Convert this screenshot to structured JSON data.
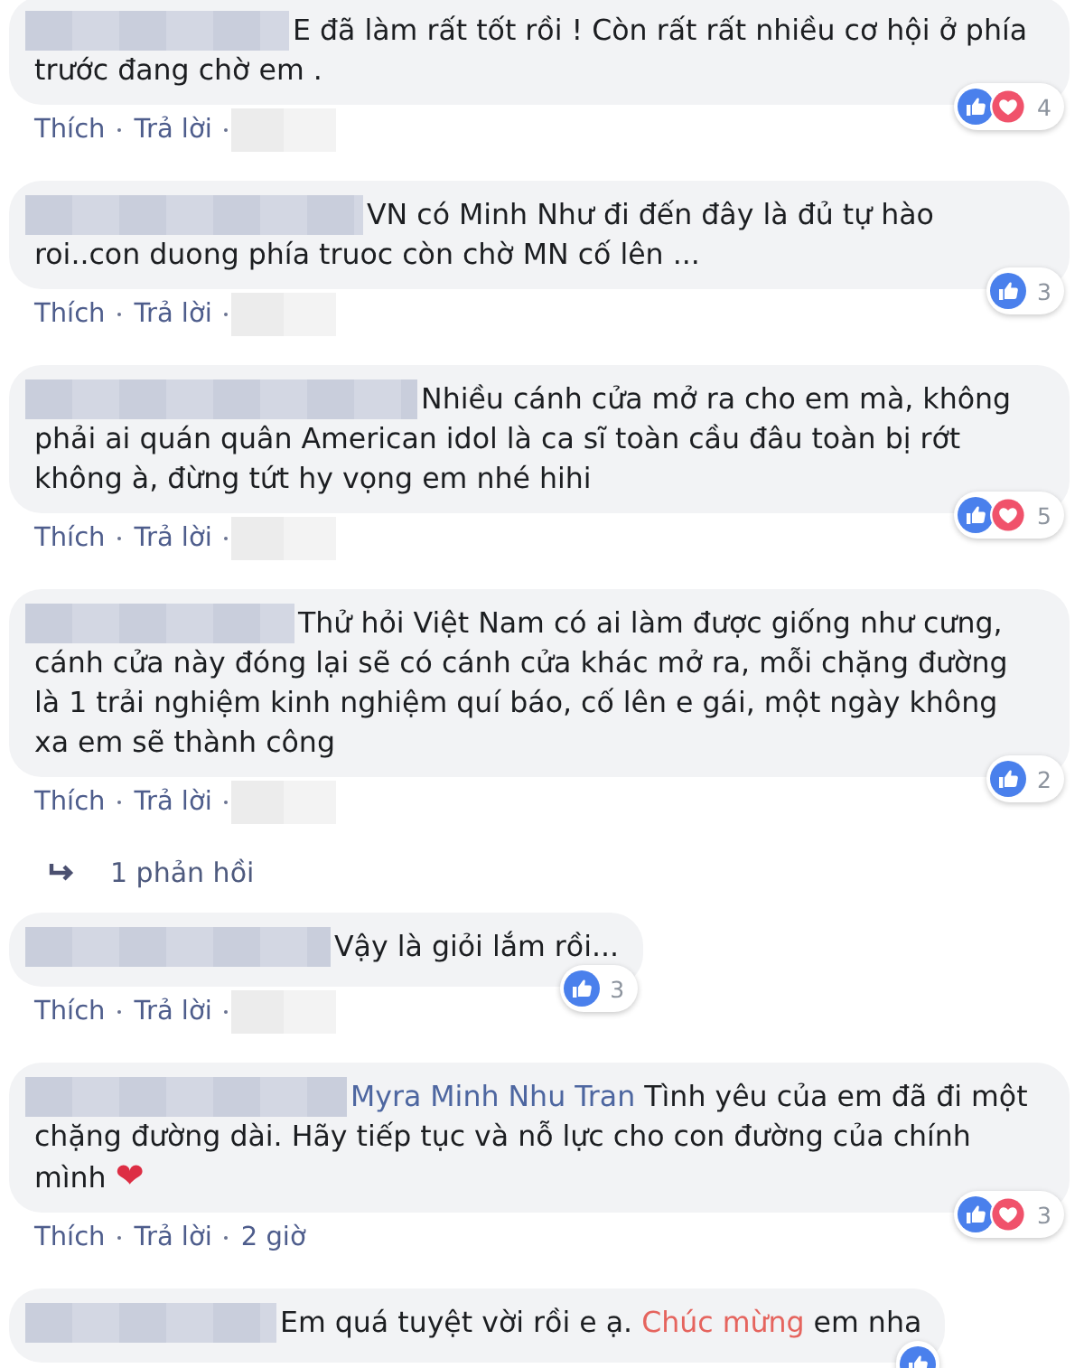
{
  "comments": [
    {
      "author_hidden": true,
      "text": [
        {
          "kind": "plain",
          "text": "E đã làm rất tốt rồi ! Còn rất rất nhiều cơ hội ở phía trước đang chờ em ."
        }
      ],
      "reactions": {
        "icons": [
          {
            "kind": "like"
          },
          {
            "kind": "love"
          }
        ],
        "count": "4"
      },
      "actions": [
        "Thích",
        "Trả lời"
      ],
      "time_hidden": true
    },
    {
      "author_hidden": true,
      "text": [
        {
          "kind": "plain",
          "text": "VN có Minh Như đi đến đây là đủ tự hào roi..con duong phía truoc còn chờ MN cố lên ..."
        }
      ],
      "reactions": {
        "icons": [
          {
            "kind": "like"
          }
        ],
        "count": "3"
      },
      "actions": [
        "Thích",
        "Trả lời"
      ],
      "time_hidden": true
    },
    {
      "author_hidden": true,
      "text": [
        {
          "kind": "plain",
          "text": "Nhiều cánh cửa mở ra cho em mà, không phải ai quán quân American idol là ca sĩ toàn cầu đâu toàn bị rớt không à, đừng tứt hy vọng em nhé hihi"
        }
      ],
      "reactions": {
        "icons": [
          {
            "kind": "like"
          },
          {
            "kind": "love"
          }
        ],
        "count": "5"
      },
      "actions": [
        "Thích",
        "Trả lời"
      ],
      "time_hidden": true
    },
    {
      "author_hidden": true,
      "text": [
        {
          "kind": "plain",
          "text": "Thử hỏi Việt Nam có ai làm được giống như cưng, cánh cửa này đóng lại sẽ có cánh cửa khác mở ra, mỗi chặng đường là 1 trải nghiệm kinh nghiệm quí báo, cố lên e gái, một ngày không xa em sẽ thành công"
        }
      ],
      "reactions": {
        "icons": [
          {
            "kind": "like"
          }
        ],
        "count": "2"
      },
      "actions": [
        "Thích",
        "Trả lời"
      ],
      "time_hidden": true,
      "replies": "1 phản hồi"
    },
    {
      "author_hidden": true,
      "text": [
        {
          "kind": "plain",
          "text": "Vậy là giỏi lắm rồi..."
        }
      ],
      "reactions": {
        "icons": [
          {
            "kind": "like"
          }
        ],
        "count": "3"
      },
      "actions": [
        "Thích",
        "Trả lời"
      ],
      "time_hidden": true
    },
    {
      "author_hidden": true,
      "text": [
        {
          "kind": "mention",
          "text": "Myra Minh Nhu Tran"
        },
        {
          "kind": "plain",
          "text": " Tình yêu của em đã đi một chặng đường dài. Hãy tiếp tục và nỗ lực cho con đường của chính mình "
        },
        {
          "kind": "emoji",
          "text": "❤"
        }
      ],
      "reactions": {
        "icons": [
          {
            "kind": "like"
          },
          {
            "kind": "love"
          }
        ],
        "count": "3"
      },
      "actions": [
        "Thích",
        "Trả lời"
      ],
      "time": "2 giờ"
    },
    {
      "author_hidden": true,
      "text": [
        {
          "kind": "plain",
          "text": "Em quá tuyệt vời rồi e ạ. "
        },
        {
          "kind": "keyword",
          "text": "Chúc mừng"
        },
        {
          "kind": "plain",
          "text": " em nha"
        }
      ],
      "reactions": {
        "icons": [
          {
            "kind": "like"
          }
        ]
      }
    }
  ]
}
